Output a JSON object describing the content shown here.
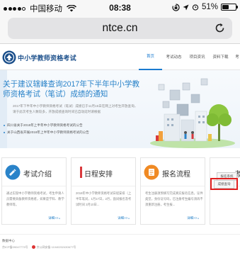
{
  "status_bar": {
    "carrier": "中国移动",
    "time": "08:38",
    "battery_percent": "51%",
    "battery_level": 0.51,
    "signal_bars": 4
  },
  "browser": {
    "address": "ntce.cn"
  },
  "site": {
    "title": "中小学教师资格考试",
    "nav": [
      "首页",
      "考试动态",
      "项目资讯",
      "资料下载",
      "考"
    ]
  },
  "banner": {
    "headline": "关于建议辖峰查询2017年下半年中小学教师资格考试（笔试）成绩的通知",
    "description": "2017年下半年中小学教师资格考试（笔试）成绩已于11月15日在网上对考生开放查询，请于此次考生人数较多，开放成绩查询时间已自动延时请根据",
    "notices": [
      "四川省关于2018年上半年中小学教师资格考试的公告",
      "关于山西省开展2018年上半年中小学教师资格考试的公告"
    ]
  },
  "cards": [
    {
      "title": "考试介绍",
      "text": "通过实现中小学教师资格考试，考生申请人员需要具备教师资格者，如果是学科、教学教师等。",
      "more": "详细>>",
      "color": "#2a83c9"
    },
    {
      "title": "日程安排",
      "text": "2018年中小学教师资格考试日程安排（上半年笔试，1月17日，2月，面试报名及考试时间 3月10日...",
      "more": "详细>>",
      "color": "#d9393c"
    },
    {
      "title": "报名流程",
      "text": "考生注册须预填写完成真实报名信息，证件类型，身份证号码，已注册考生编号须再不须重新注册，考生报...",
      "more": "详细>>",
      "color": "#f08a24"
    },
    {
      "title": "考",
      "text": "",
      "more": "",
      "color": "#2a83c9"
    }
  ],
  "side_buttons": {
    "register_label": "报名系统",
    "score_label": "成绩查询"
  },
  "footer": {
    "line1": "数据中心",
    "icp": "京ICP备09047773号",
    "record": "京公网安备 11040202430677号"
  },
  "colors": {
    "brand_blue": "#1a4e8a",
    "accent_blue": "#2a83c9",
    "highlight_red": "#e02020"
  }
}
